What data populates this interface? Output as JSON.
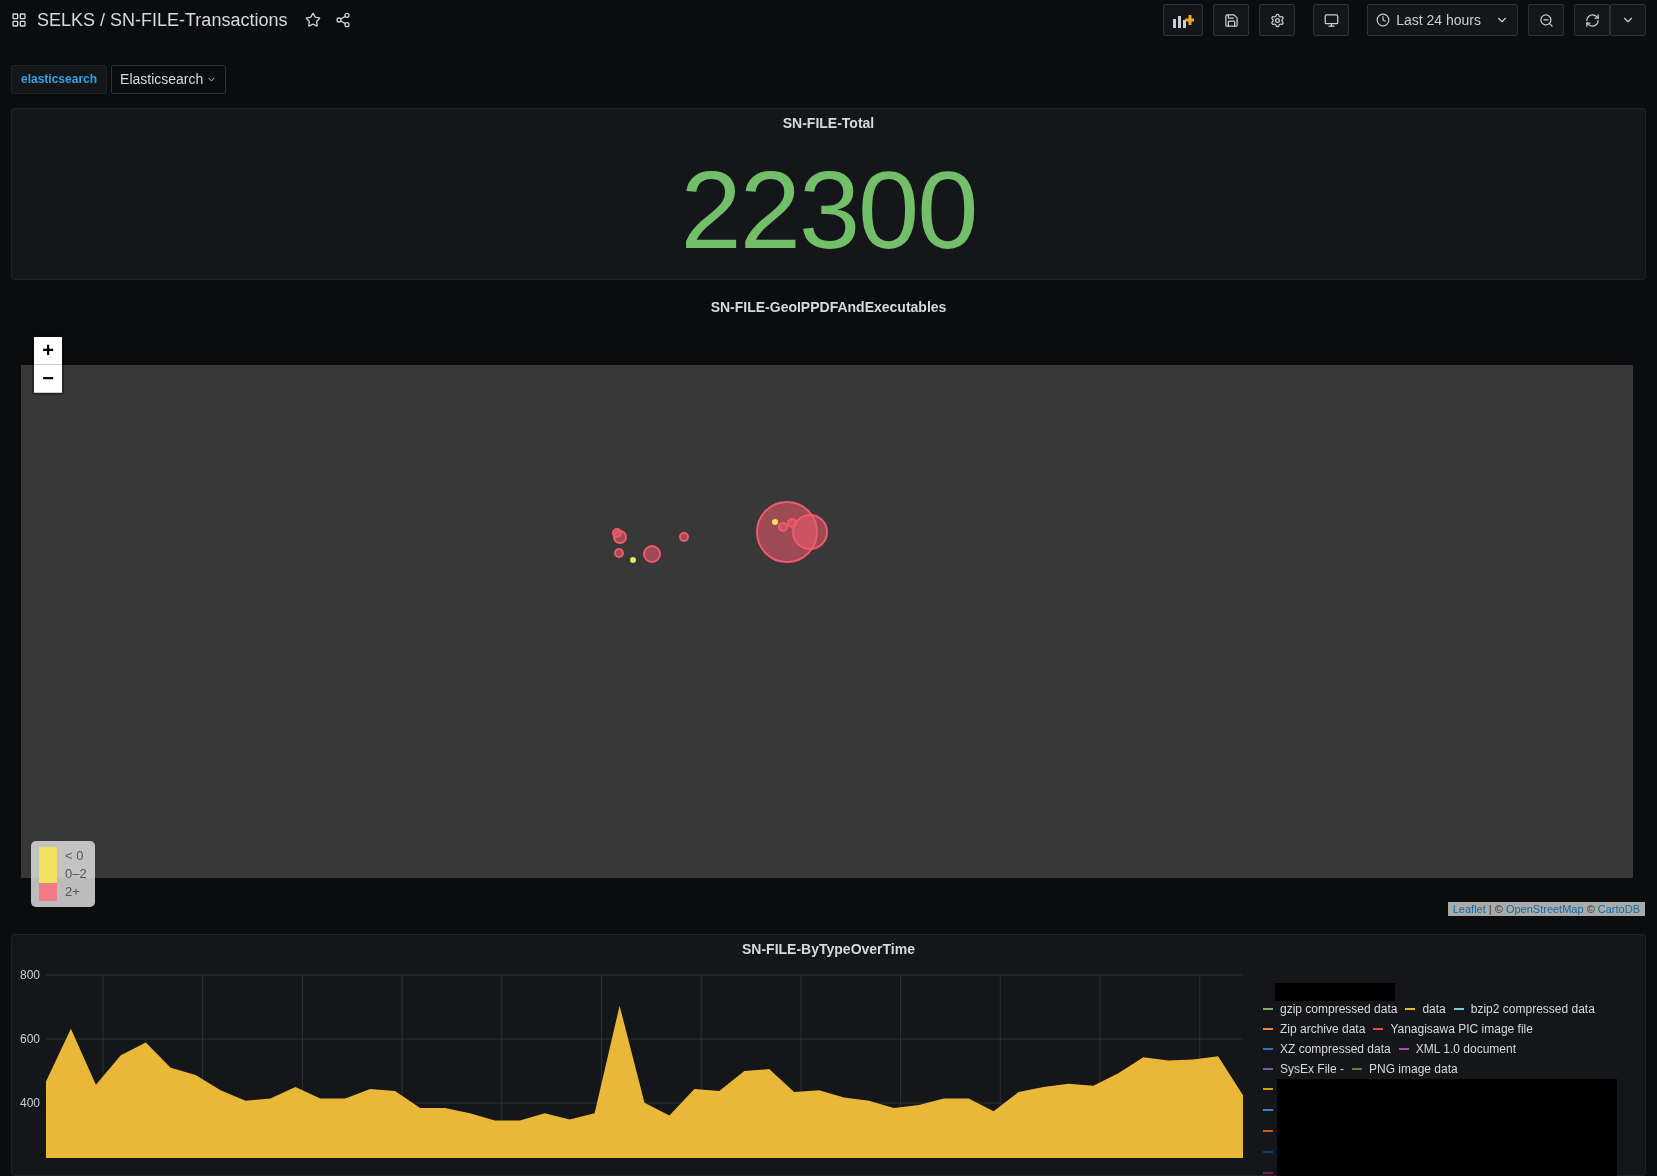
{
  "header": {
    "breadcrumb": "SELKS / SN-FILE-Transactions",
    "time_range": "Last 24 hours"
  },
  "variables": [
    {
      "label": "elasticsearch",
      "value": "Elasticsearch"
    }
  ],
  "stat_panel": {
    "title": "SN-FILE-Total",
    "value": "22300"
  },
  "map_panel": {
    "title": "SN-FILE-GeoIPPDFAndExecutables",
    "zoom_in": "+",
    "zoom_out": "−",
    "legend": [
      {
        "label": "< 0",
        "color": "#f2e05f"
      },
      {
        "label": "0–2",
        "color": "#f2e05f"
      },
      {
        "label": "2+",
        "color": "#f07a85"
      }
    ],
    "attribution": [
      {
        "text": "Leaflet",
        "link": true
      },
      {
        "text": "| ©",
        "link": false
      },
      {
        "text": "OpenStreetMap",
        "link": true
      },
      {
        "text": "©",
        "link": false
      },
      {
        "text": "CartoDB",
        "link": true
      }
    ]
  },
  "graph_panel": {
    "title": "SN-FILE-ByTypeOverTime",
    "legend": [
      {
        "label": "gzip compressed data",
        "color": "#7eb26d"
      },
      {
        "label": "data",
        "color": "#eab839"
      },
      {
        "label": "bzip2 compressed data",
        "color": "#6ed0e0"
      },
      {
        "label": "Zip archive data",
        "color": "#ef843c"
      },
      {
        "label": "Yanagisawa PIC image file",
        "color": "#e24d42"
      },
      {
        "label": "XZ compressed data",
        "color": "#1f78c1"
      },
      {
        "label": "XML 1.0 document",
        "color": "#ba43a9"
      },
      {
        "label": "SysEx File -",
        "color": "#705da0"
      },
      {
        "label": "PNG image data",
        "color": "#508642"
      }
    ],
    "hidden_legend": [
      {
        "color": "#cca300"
      },
      {
        "color": "#447ebc"
      },
      {
        "color": "#c15c17"
      },
      {
        "color": "#0a437c"
      },
      {
        "color": "#6d1f62"
      }
    ],
    "chart_data": {
      "type": "area",
      "grid": true,
      "ylim": [
        228,
        800
      ],
      "yticks": [
        400,
        600,
        800
      ],
      "series": [
        {
          "color": "#eab839",
          "values": [
            467,
            632,
            457,
            549,
            589,
            510,
            487,
            440,
            407,
            414,
            450,
            414,
            414,
            444,
            437,
            384,
            384,
            368,
            345,
            345,
            368,
            348,
            368,
            704,
            401,
            361,
            444,
            437,
            500,
            506,
            434,
            440,
            417,
            407,
            384,
            394,
            414,
            414,
            374,
            434,
            450,
            460,
            454,
            493,
            543,
            533,
            536,
            546,
            424
          ]
        }
      ]
    }
  }
}
